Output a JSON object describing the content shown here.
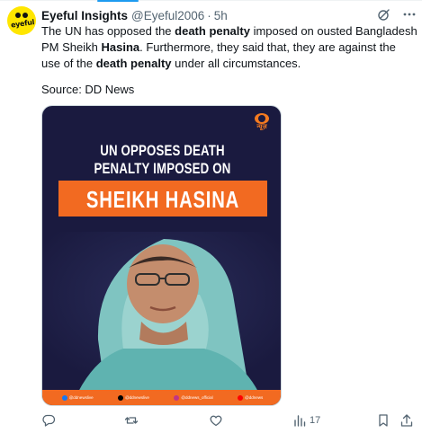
{
  "tweet": {
    "author_name": "Eyeful Insights",
    "author_handle": "@Eyeful2006",
    "separator": "·",
    "time": "5h",
    "avatar_text": "eyeful",
    "body": [
      {
        "text": "The UN has opposed the ",
        "bold": false
      },
      {
        "text": "death penalty",
        "bold": true
      },
      {
        "text": " imposed on ousted Bangladesh PM Sheikh ",
        "bold": false
      },
      {
        "text": "Hasina",
        "bold": true
      },
      {
        "text": ". Furthermore, they said that, they are against the use of the ",
        "bold": false
      },
      {
        "text": "death penalty",
        "bold": true
      },
      {
        "text": " under all circumstances.",
        "bold": false
      }
    ],
    "source": "Source: DD News"
  },
  "media": {
    "logo_text": "न्यूज़",
    "headline_line1": "UN OPPOSES DEATH",
    "headline_line2": "PENALTY IMPOSED ON",
    "banner_text": "SHEIKH HASINA",
    "socials": [
      "@ddnewslive",
      "@ddnewslive",
      "@ddnews_official",
      "@ddnews"
    ],
    "colors": {
      "background": "#1a1a3f",
      "accent": "#f26a21"
    }
  },
  "actions": {
    "views_count": "17"
  },
  "icons": [
    "grok-icon",
    "more-icon",
    "reply-icon",
    "retweet-icon",
    "like-icon",
    "views-icon",
    "bookmark-icon",
    "share-icon"
  ],
  "colors": {
    "link_blue": "#1d9bf0",
    "secondary_text": "#536471"
  }
}
